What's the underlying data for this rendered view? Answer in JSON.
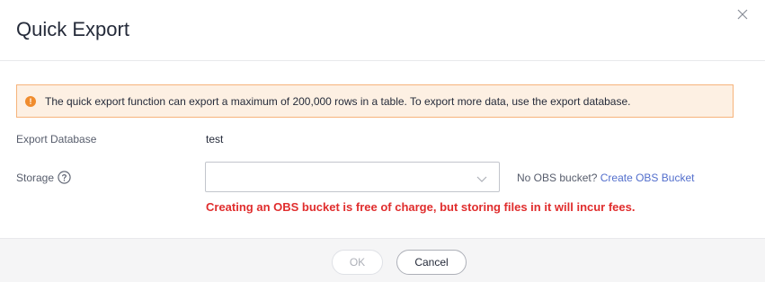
{
  "dialog": {
    "title": "Quick Export"
  },
  "alert": {
    "icon": "warning-circle-icon",
    "color": "#f08c2e",
    "background": "#fdf0e3",
    "message": "The quick export function can export a maximum of 200,000 rows in a table. To export more data, use the export database."
  },
  "export_database": {
    "label": "Export Database",
    "value": "test"
  },
  "storage": {
    "label": "Storage",
    "help_icon": "question-circle-icon",
    "selected_value": "",
    "obs_hint": "No OBS bucket?",
    "create_link": "Create OBS Bucket",
    "link_color": "#526ecc",
    "warning": "Creating an OBS bucket is free of charge, but storing files in it will incur fees.",
    "warning_color": "#e02d2d"
  },
  "footer": {
    "ok_label": "OK",
    "cancel_label": "Cancel"
  }
}
